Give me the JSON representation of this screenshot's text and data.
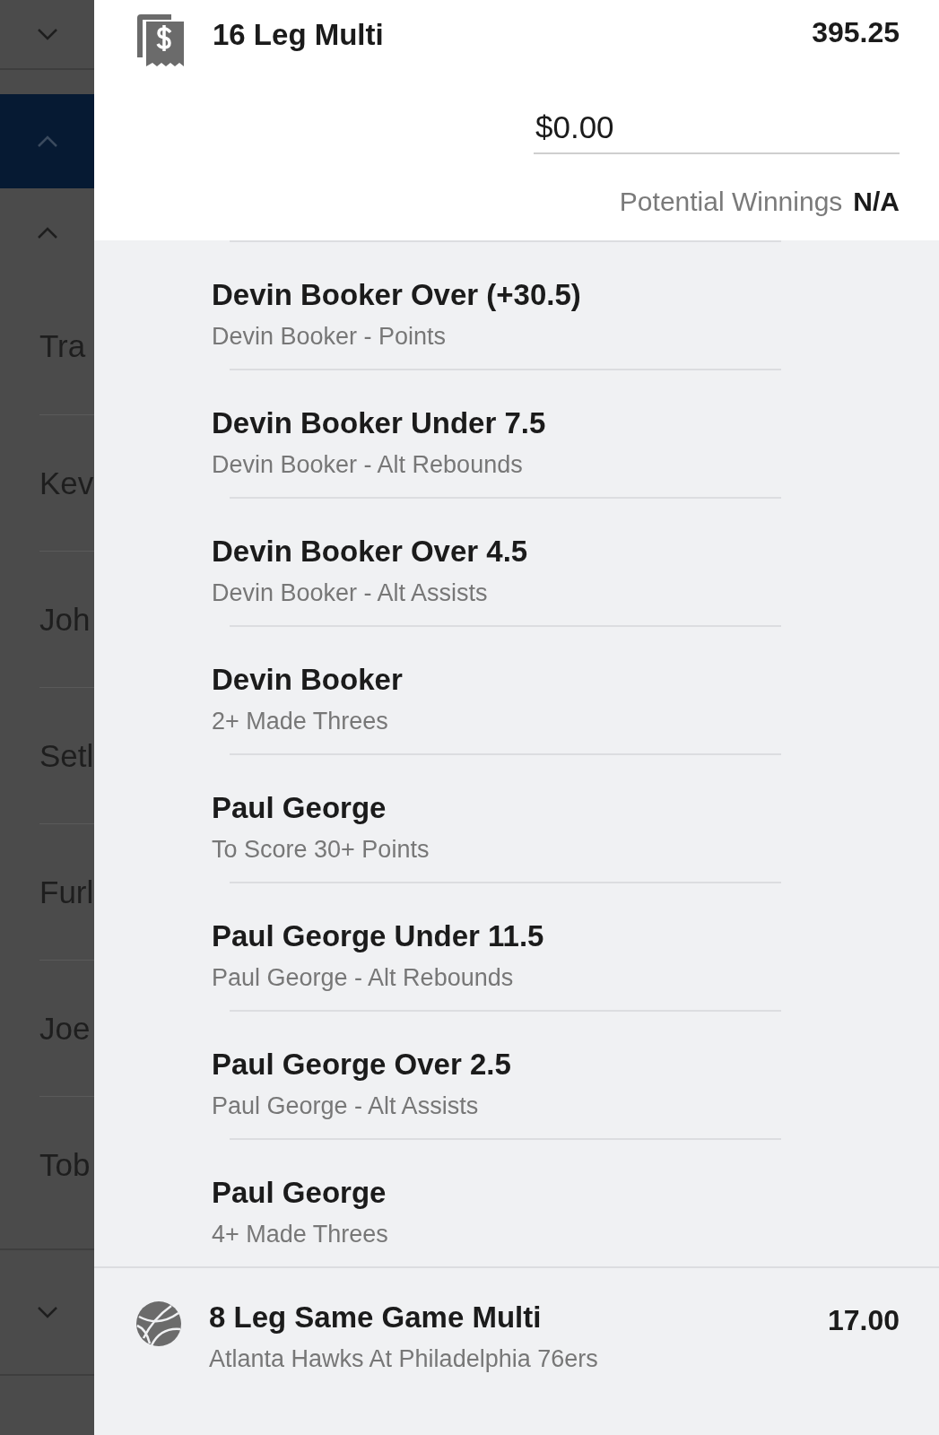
{
  "side_list": {
    "names": [
      "Tra",
      "Kev",
      "Joh",
      "Setl",
      "Furl",
      "Joe",
      "Tob"
    ]
  },
  "bets": [
    {
      "kind": "multi",
      "title": "16 Leg Multi",
      "odds": "395.25",
      "stake": {
        "value": "$0.00"
      },
      "winnings_label": "Potential Winnings",
      "winnings_value": "N/A",
      "legs": [
        {
          "title": "Devin Booker Over (+30.5)",
          "market": "Devin Booker - Points"
        },
        {
          "title": "Devin Booker Under 7.5",
          "market": "Devin Booker - Alt Rebounds"
        },
        {
          "title": "Devin Booker Over 4.5",
          "market": "Devin Booker - Alt Assists"
        },
        {
          "title": "Devin Booker",
          "market": "2+ Made Threes"
        },
        {
          "title": "Paul George",
          "market": "To Score 30+ Points"
        },
        {
          "title": "Paul George Under 11.5",
          "market": "Paul George - Alt Rebounds"
        },
        {
          "title": "Paul George Over 2.5",
          "market": "Paul George - Alt Assists"
        },
        {
          "title": "Paul George",
          "market": "4+ Made Threes"
        }
      ]
    },
    {
      "kind": "same_game",
      "title": "8 Leg Same Game Multi",
      "odds": "17.00",
      "event": "Atlanta Hawks At Philadelphia 76ers"
    }
  ]
}
